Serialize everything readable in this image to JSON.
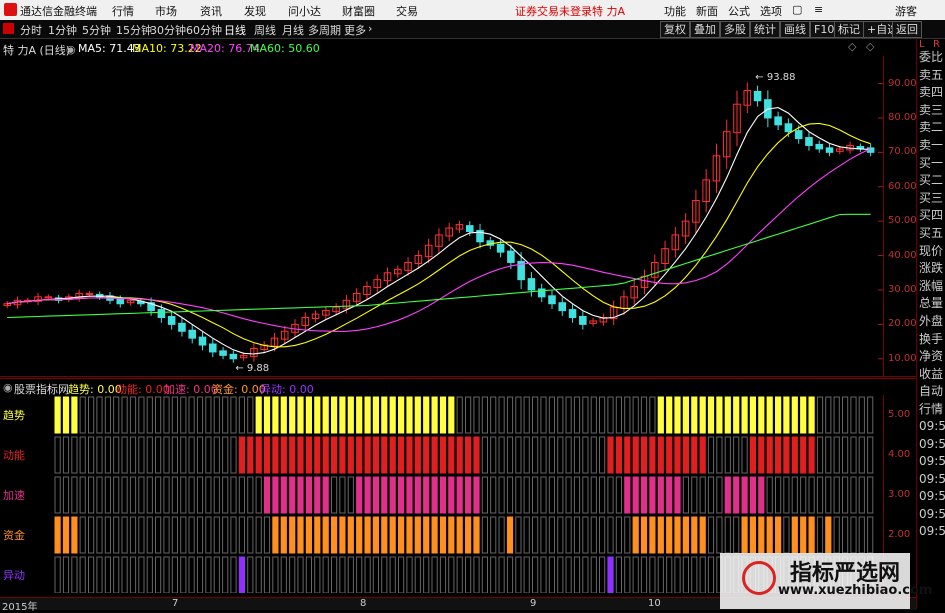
{
  "titlebar": {
    "app_name": "通达信金融终端",
    "menus": [
      "行情",
      "市场",
      "资讯",
      "发现",
      "问小达",
      "财富圈",
      "交易"
    ],
    "warning": "证券交易未登录",
    "stock": "特 力A",
    "right_buttons": [
      "功能",
      "新面",
      "公式",
      "选项"
    ],
    "guest": "游客"
  },
  "toolbar": {
    "periods": [
      "分时",
      "1分钟",
      "5分钟",
      "15分钟",
      "30分钟",
      "60分钟",
      "日线",
      "周线",
      "月线",
      "多周期",
      "更多"
    ],
    "selected": "日线",
    "right": [
      "复权",
      "叠加",
      "多股",
      "统计",
      "画线",
      "F10",
      "标记",
      "+自选",
      "返回"
    ]
  },
  "ma_line": {
    "stock_label": "特 力A (日线)",
    "ma5": "MA5: 71.43",
    "ma10": "MA10: 73.22",
    "ma20": "MA20: 76.74",
    "ma60": "MA60: 50.60",
    "colors": {
      "ma5": "#ffffff",
      "ma10": "#ffff00",
      "ma20": "#ff40ff",
      "ma60": "#40ff40"
    }
  },
  "chart_data": [
    {
      "type": "candlestick",
      "y_ticks": [
        "90.00",
        "80.00",
        "70.00",
        "60.00",
        "50.00",
        "40.00",
        "30.00",
        "20.00",
        "10.00"
      ],
      "ylim": [
        5,
        98
      ],
      "high_label": "93.88",
      "low_label": "9.88",
      "closes": [
        26,
        27,
        27,
        28,
        28,
        27,
        28,
        29,
        29,
        28,
        27,
        26,
        27,
        26,
        24,
        22,
        20,
        18,
        16,
        14,
        12,
        11,
        10,
        11,
        13,
        14,
        16,
        18,
        20,
        22,
        23,
        24,
        25,
        27,
        29,
        31,
        33,
        35,
        36,
        38,
        40,
        43,
        46,
        48,
        49,
        47,
        44,
        43,
        41,
        38,
        33,
        30,
        28,
        26,
        24,
        22,
        20,
        21,
        22,
        25,
        28,
        31,
        34,
        38,
        42,
        46,
        50,
        56,
        62,
        69,
        76,
        84,
        88,
        85,
        80,
        78,
        76,
        74,
        72,
        71,
        70,
        71,
        72,
        71,
        70
      ]
    },
    {
      "type": "indicator_bars",
      "header": "股票指标网",
      "rows": [
        {
          "name": "趋势",
          "value": "0.00",
          "color": "#ffff40",
          "active": [
            [
              0,
              3
            ],
            [
              24,
              48
            ],
            [
              72,
              91
            ]
          ]
        },
        {
          "name": "动能",
          "value": "0.00",
          "color": "#e02020",
          "active": [
            [
              22,
              51
            ],
            [
              66,
              78
            ],
            [
              83,
              91
            ]
          ]
        },
        {
          "name": "加速",
          "value": "0.00",
          "color": "#e0308a",
          "active": [
            [
              25,
              33
            ],
            [
              36,
              51
            ],
            [
              68,
              75
            ],
            [
              80,
              85
            ]
          ]
        },
        {
          "name": "资金",
          "value": "0.00",
          "color": "#ff9020",
          "active": [
            [
              0,
              3
            ],
            [
              26,
              51
            ],
            [
              54,
              55
            ],
            [
              69,
              78
            ],
            [
              82,
              87
            ],
            [
              88,
              91
            ],
            [
              92,
              93
            ]
          ]
        },
        {
          "name": "异动",
          "value": "0.00",
          "color": "#9030ff",
          "active": [
            [
              22,
              23
            ],
            [
              66,
              67
            ]
          ]
        }
      ],
      "y_ticks": [
        "5.00",
        "4.00",
        "3.00",
        "2.00"
      ],
      "bar_count": 98
    }
  ],
  "date_axis": [
    "2015年",
    "7",
    "8",
    "9",
    "10"
  ],
  "sidepanel": [
    "委比",
    "卖五",
    "卖四",
    "卖三",
    "卖二",
    "卖一",
    "买一",
    "买二",
    "买三",
    "买四",
    "买五",
    "现价",
    "涨跌",
    "涨幅",
    "总量",
    "外盘",
    "换手",
    "净资",
    "收益"
  ],
  "side_tabs_top": [
    "L",
    "R"
  ],
  "side_bottom": [
    "自动",
    "行情",
    "09:5",
    "09:5",
    "09:5",
    "09:5",
    "09:5",
    "09:5",
    "09:5"
  ],
  "watermark": {
    "title": "指标严选网",
    "url": "www.xuezhibiao.com"
  }
}
